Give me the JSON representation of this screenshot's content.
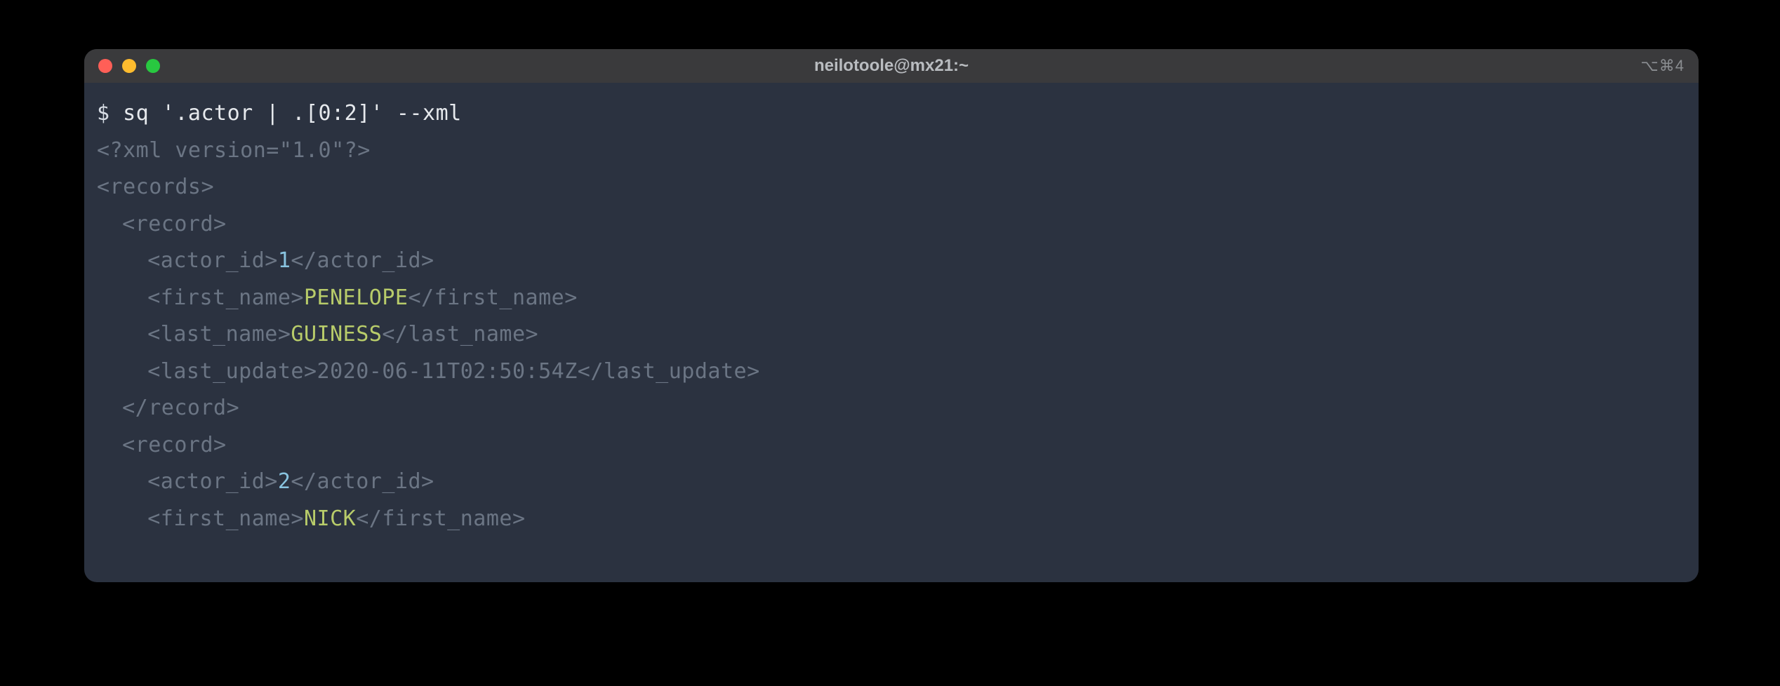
{
  "titlebar": {
    "title": "neilotoole@mx21:~",
    "right_indicator": "⌥⌘4"
  },
  "prompt": {
    "symbol": "$",
    "command": "sq '.actor | .[0:2]' --xml"
  },
  "output": {
    "xml_decl": "<?xml version=\"1.0\"?>",
    "root_open": "<records>",
    "record_open": "<record>",
    "record_close": "</record>",
    "tags": {
      "actor_id_open": "<actor_id>",
      "actor_id_close": "</actor_id>",
      "first_name_open": "<first_name>",
      "first_name_close": "</first_name>",
      "last_name_open": "<last_name>",
      "last_name_close": "</last_name>",
      "last_update_open": "<last_update>",
      "last_update_close": "</last_update>"
    },
    "records": [
      {
        "actor_id": "1",
        "first_name": "PENELOPE",
        "last_name": "GUINESS",
        "last_update": "2020-06-11T02:50:54Z"
      },
      {
        "actor_id": "2",
        "first_name": "NICK"
      }
    ]
  }
}
